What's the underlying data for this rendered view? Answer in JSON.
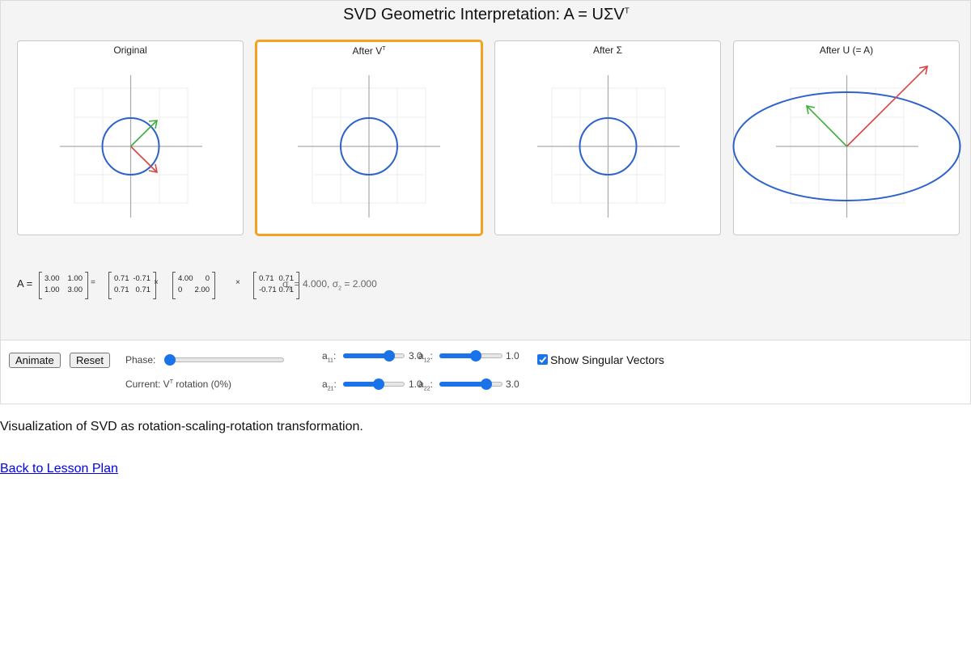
{
  "title": "SVD Geometric Interpretation: A = UΣV",
  "title_sup": "T",
  "panels": [
    {
      "title": "Original",
      "sup": "",
      "selected": false
    },
    {
      "title": "After V",
      "sup": "T",
      "selected": true
    },
    {
      "title": "After Σ",
      "sup": "",
      "selected": false
    },
    {
      "title": "After U (= A)",
      "sup": "",
      "selected": false
    }
  ],
  "equation": {
    "a_label": "A =",
    "A": [
      [
        "3.00",
        "1.00"
      ],
      [
        "1.00",
        "3.00"
      ]
    ],
    "eq_sign": "=",
    "U": [
      [
        "0.71",
        "-0.71"
      ],
      [
        "0.71",
        "0.71"
      ]
    ],
    "times1": "×",
    "Sigma": [
      [
        "4.00",
        "0"
      ],
      [
        "0",
        "2.00"
      ]
    ],
    "times2": "×",
    "Vt": [
      [
        "0.71",
        "0.71"
      ],
      [
        "-0.71",
        "0.71"
      ]
    ],
    "sigma1_label": "σ",
    "sigma1_sub": "1",
    "sigma1_value": "= 4.000,",
    "sigma2_label": "σ",
    "sigma2_sub": "2",
    "sigma2_value": "= 2.000"
  },
  "controls": {
    "animate_label": "Animate",
    "reset_label": "Reset",
    "phase_label": "Phase:",
    "phase_value": 0,
    "current_prefix": "Current: V",
    "current_sup": "T",
    "current_suffix": " rotation (0%)",
    "sliders": [
      {
        "name": "a",
        "sub": "11",
        "value": 3.0,
        "display": "3.0",
        "min": -5,
        "max": 5
      },
      {
        "name": "a",
        "sub": "12",
        "value": 1.0,
        "display": "1.0",
        "min": -5,
        "max": 5
      },
      {
        "name": "a",
        "sub": "21",
        "value": 1.0,
        "display": "1.0",
        "min": -5,
        "max": 5
      },
      {
        "name": "a",
        "sub": "22",
        "value": 3.0,
        "display": "3.0",
        "min": -5,
        "max": 5
      }
    ],
    "show_vectors_label": "Show Singular Vectors",
    "show_vectors_checked": true
  },
  "description": "Visualization of SVD as rotation-scaling-rotation transformation.",
  "back_link": "Back to Lesson Plan",
  "colors": {
    "circle": "#2c62c9",
    "vector_red": "#d64545",
    "vector_green": "#3fae3f",
    "selected_border": "#f5a020",
    "accent": "#1a73e8"
  }
}
